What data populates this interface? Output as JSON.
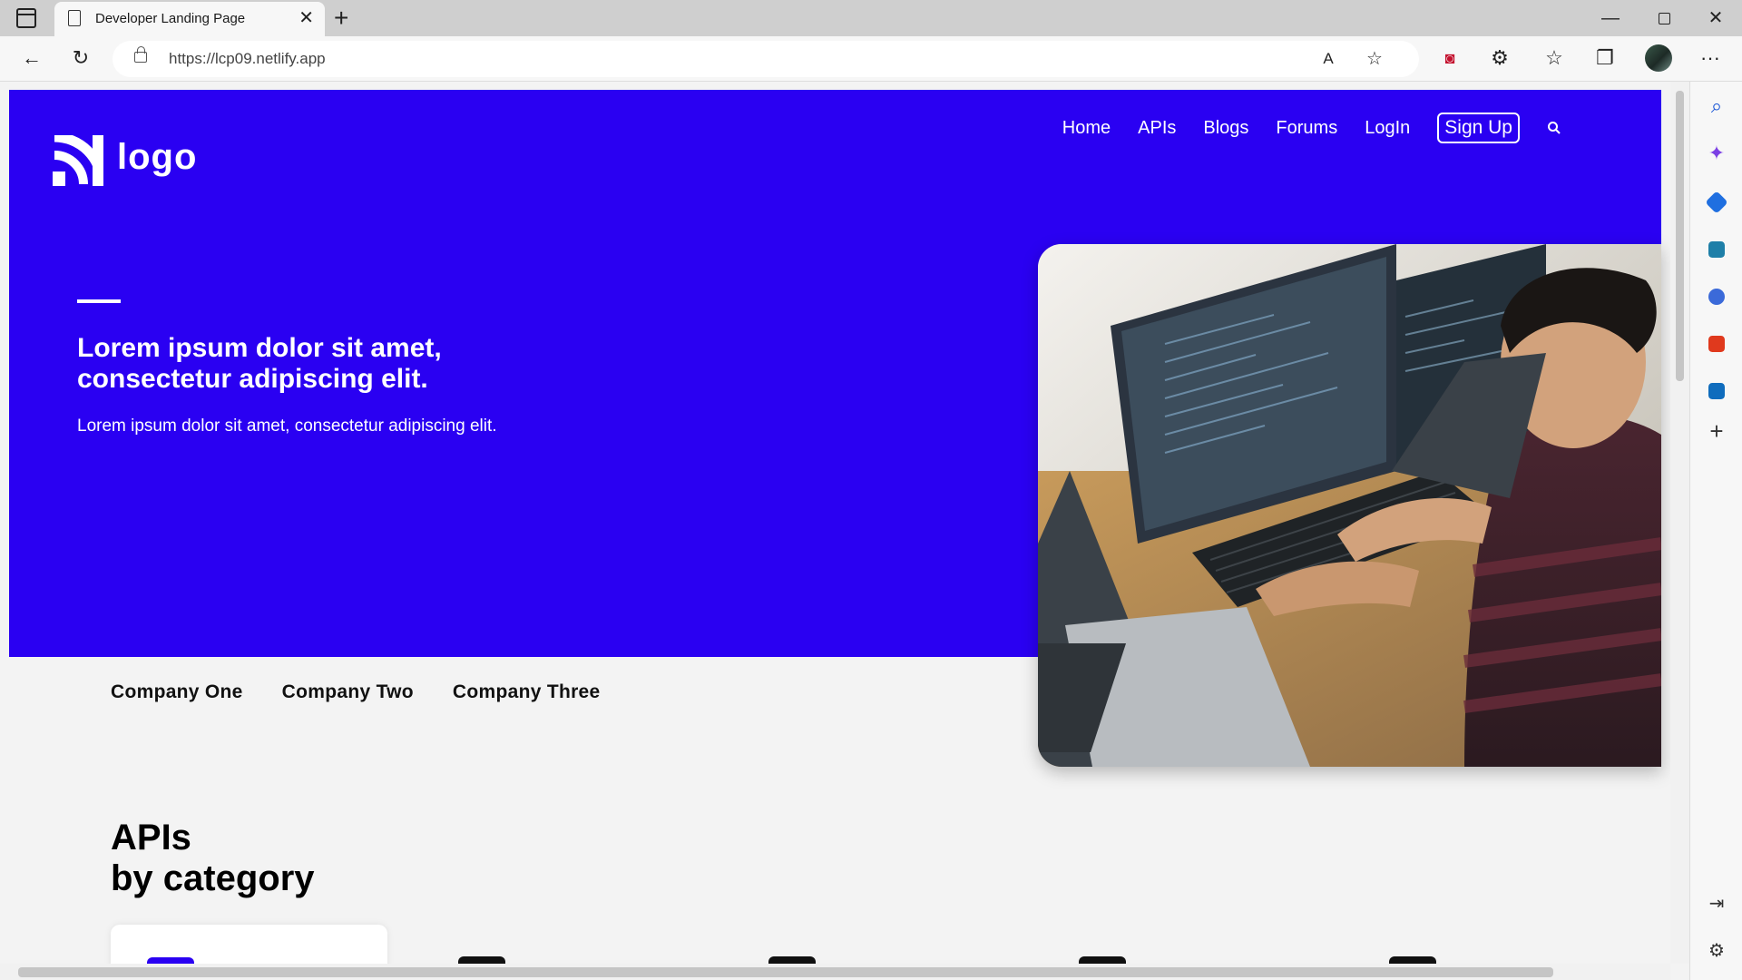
{
  "browser": {
    "tab_title": "Developer Landing Page",
    "url": "https://lcp09.netlify.app",
    "tab_close": "✕",
    "new_tab": "+",
    "minimize": "—",
    "close": "✕",
    "more": "···"
  },
  "site": {
    "logo_text": "logo",
    "nav": {
      "home": "Home",
      "apis": "APIs",
      "blogs": "Blogs",
      "forums": "Forums",
      "login": "LogIn",
      "signup": "Sign Up"
    },
    "hero": {
      "title": "Lorem ipsum dolor sit amet, consectetur adipiscing elit.",
      "subtitle": "Lorem ipsum dolor sit amet, consectetur adipiscing elit."
    },
    "companies": [
      "Company One",
      "Company Two",
      "Company Three"
    ],
    "apis_heading_line1": "APIs",
    "apis_heading_line2": "by category"
  },
  "colors": {
    "brand": "#2a00f2",
    "page_bg": "#f3f3f3"
  }
}
